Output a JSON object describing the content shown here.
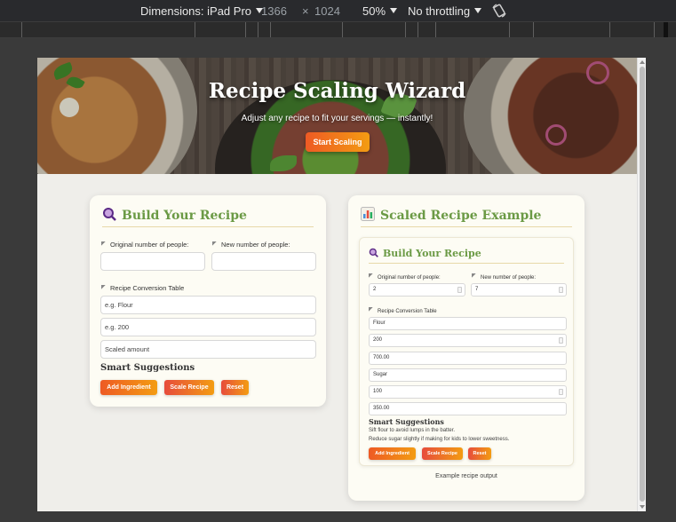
{
  "devtools": {
    "dimensions_label": "Dimensions: iPad Pro",
    "width": "1366",
    "times": "×",
    "height": "1024",
    "zoom": "50%",
    "throttling": "No throttling",
    "rotate_icon": "rotate-icon"
  },
  "hero": {
    "title": "Recipe Scaling Wizard",
    "subtitle": "Adjust any recipe to fit your servings — instantly!",
    "cta": "Start Scaling"
  },
  "builder": {
    "title": "Build Your Recipe",
    "icon": "magnifier-icon",
    "original_label": "Original number of people:",
    "new_label": "New number of people:",
    "original_value": "",
    "new_value": "",
    "table_label": "Recipe Conversion Table",
    "ingredient_placeholder": "e.g. Flour",
    "amount_placeholder": "e.g. 200",
    "scaled_placeholder": "Scaled amount",
    "suggestions_title": "Smart Suggestions",
    "buttons": {
      "add": "Add Ingredient",
      "scale": "Scale Recipe",
      "reset": "Reset"
    }
  },
  "example": {
    "title": "Scaled Recipe Example",
    "icon": "bar-chart-icon",
    "inner_title": "Build Your Recipe",
    "original_label": "Original number of people:",
    "new_label": "New number of people:",
    "original_value": "2",
    "new_value": "7",
    "table_label": "Recipe Conversion Table",
    "rows": [
      {
        "ingredient": "Flour",
        "amount": "200",
        "scaled": "700.00"
      },
      {
        "ingredient": "Sugar",
        "amount": "100",
        "scaled": "350.00"
      }
    ],
    "suggestions_title": "Smart Suggestions",
    "suggestions": [
      "Sift flour to avoid lumps in the batter.",
      "Reduce sugar slightly if making for kids to lower sweetness."
    ],
    "buttons": {
      "add": "Add Ingredient",
      "scale": "Scale Recipe",
      "reset": "Reset"
    },
    "caption": "Example recipe output"
  },
  "colors": {
    "accent_green": "#6b9a45",
    "button_orange": "#ee5a24",
    "button_amber": "#f39c12"
  }
}
